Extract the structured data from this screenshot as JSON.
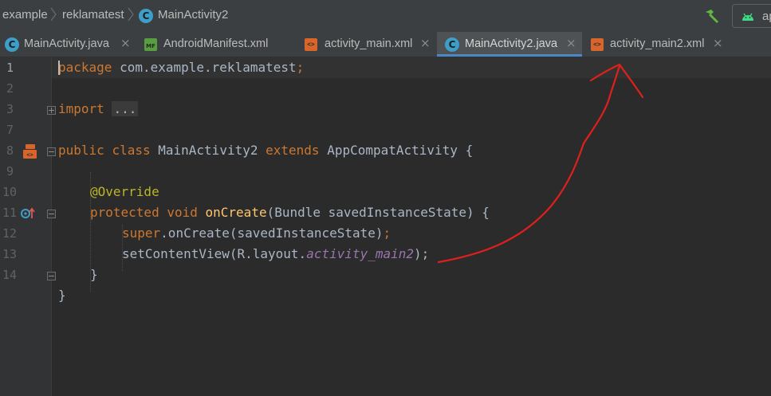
{
  "breadcrumb": {
    "items": [
      "example",
      "reklamatest",
      "MainActivity2"
    ]
  },
  "toolbar": {
    "run_config_label": "ap"
  },
  "tabs": [
    {
      "label": "MainActivity.java",
      "icon": "java-class-icon",
      "active": false
    },
    {
      "label": "AndroidManifest.xml",
      "icon": "manifest-icon",
      "active": false
    },
    {
      "label": "activity_main.xml",
      "icon": "xml-layout-icon",
      "active": false
    },
    {
      "label": "MainActivity2.java",
      "icon": "java-class-icon",
      "active": true
    },
    {
      "label": "activity_main2.xml",
      "icon": "xml-layout-icon",
      "active": false
    }
  ],
  "tab_close_glyph": "×",
  "editor": {
    "line_numbers": [
      "1",
      "2",
      "3",
      "7",
      "8",
      "9",
      "10",
      "11",
      "12",
      "13",
      "14"
    ],
    "current_line": "1",
    "lines": {
      "l1": {
        "kw": "package",
        "rest": " com.example.reklamatest",
        "semi": ";"
      },
      "l3": {
        "kw": "import",
        "collapsed": "..."
      },
      "l7": {
        "kw1": "public",
        "kw2": "class",
        "name": "MainActivity2",
        "kw3": "extends",
        "rest": " AppCompatActivity {"
      },
      "l9": {
        "annotation": "@Override"
      },
      "l10": {
        "kw1": "protected",
        "kw2": "void",
        "fn": "onCreate",
        "rest": "(Bundle savedInstanceState) {"
      },
      "l11": {
        "kw": "super",
        "rest": ".onCreate(savedInstanceState)",
        "semi": ";"
      },
      "l12": {
        "call": "setContentView(R.layout.",
        "field": "activity_main2",
        "close": ");"
      },
      "l13": {
        "text": "}"
      },
      "l14": {
        "text": "}"
      }
    }
  },
  "colors": {
    "keyword": "#cc7832",
    "annotation": "#bbb529",
    "function": "#ffc66d",
    "static_field": "#9876aa",
    "plain": "#a9b7c6",
    "annotation_arrow": "#e0201b",
    "active_tab_underline": "#4a88c7"
  }
}
